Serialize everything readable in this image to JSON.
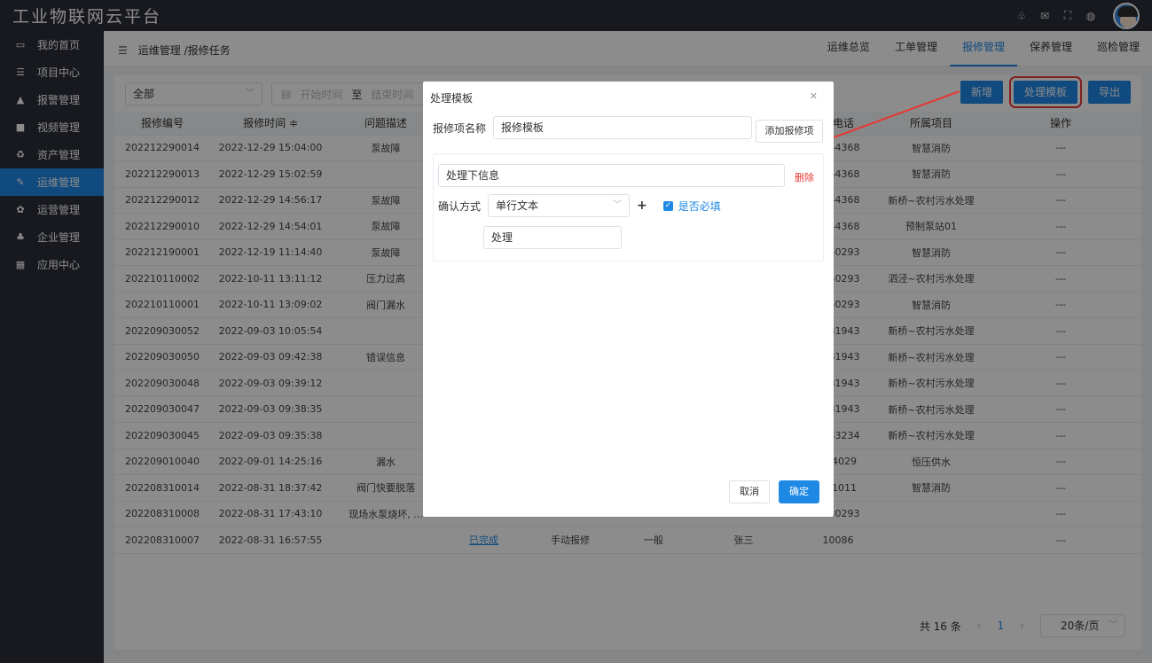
{
  "app": {
    "title": "工业物联网云平台"
  },
  "topbar_icons": [
    "bell-icon",
    "mail-icon",
    "fullscreen-icon",
    "globe-icon"
  ],
  "sidebar": {
    "items": [
      {
        "label": "我的首页",
        "icon": "laptop-icon"
      },
      {
        "label": "项目中心",
        "icon": "list-icon"
      },
      {
        "label": "报警管理",
        "icon": "bell-icon"
      },
      {
        "label": "视频管理",
        "icon": "video-icon"
      },
      {
        "label": "资产管理",
        "icon": "recycle-icon"
      },
      {
        "label": "运维管理",
        "icon": "wrench-icon",
        "active": true
      },
      {
        "label": "运营管理",
        "icon": "cubes-icon"
      },
      {
        "label": "企业管理",
        "icon": "sitemap-icon"
      },
      {
        "label": "应用中心",
        "icon": "grid-icon"
      }
    ]
  },
  "breadcrumb": {
    "text": "运维管理 /报修任务"
  },
  "tabs": [
    {
      "label": "运维总览"
    },
    {
      "label": "工单管理"
    },
    {
      "label": "报修管理",
      "active": true
    },
    {
      "label": "保养管理"
    },
    {
      "label": "巡检管理"
    }
  ],
  "filters": {
    "status_value": "全部",
    "start_placeholder": "开始时间",
    "range_sep": "至",
    "end_placeholder": "结束时间"
  },
  "buttons": {
    "add": "新增",
    "template": "处理模板",
    "export": "导出"
  },
  "table": {
    "headers": [
      "报修编号",
      "报修时间 ≑",
      "问题描述",
      "",
      "",
      "",
      "",
      "系电话",
      "所属项目",
      "操作"
    ],
    "rows": [
      [
        "202212290014",
        "2022-12-29 15:04:00",
        "泵故障",
        "",
        "",
        "",
        "",
        "3654368",
        "智慧消防",
        "---"
      ],
      [
        "202212290013",
        "2022-12-29 15:02:59",
        "",
        "",
        "",
        "",
        "",
        "3654368",
        "智慧消防",
        "---"
      ],
      [
        "202212290012",
        "2022-12-29 14:56:17",
        "泵故障",
        "",
        "",
        "",
        "",
        "3654368",
        "新桥~农村污水处理",
        "---"
      ],
      [
        "202212290010",
        "2022-12-29 14:54:01",
        "泵故障",
        "",
        "",
        "",
        "",
        "3654368",
        "预制泵站01",
        "---"
      ],
      [
        "202212190001",
        "2022-12-19 11:14:40",
        "泵故障",
        "",
        "",
        "",
        "",
        "1050293",
        "智慧消防",
        "---"
      ],
      [
        "202210110002",
        "2022-10-11 13:11:12",
        "压力过高",
        "",
        "",
        "",
        "",
        "1050293",
        "泗泾~农村污水处理",
        "---"
      ],
      [
        "202210110001",
        "2022-10-11 13:09:02",
        "阀门漏水",
        "",
        "",
        "",
        "",
        "1050293",
        "智慧消防",
        "---"
      ],
      [
        "202209030052",
        "2022-09-03 10:05:54",
        "",
        "",
        "",
        "",
        "",
        "4381943",
        "新桥~农村污水处理",
        "---"
      ],
      [
        "202209030050",
        "2022-09-03 09:42:38",
        "错误信息",
        "",
        "",
        "",
        "",
        "4381943",
        "新桥~农村污水处理",
        "---"
      ],
      [
        "202209030048",
        "2022-09-03 09:39:12",
        "",
        "",
        "",
        "",
        "",
        "4381943",
        "新桥~农村污水处理",
        "---"
      ],
      [
        "202209030047",
        "2022-09-03 09:38:35",
        "",
        "",
        "",
        "",
        "",
        "4381943",
        "新桥~农村污水处理",
        "---"
      ],
      [
        "202209030045",
        "2022-09-03 09:35:38",
        "",
        "",
        "",
        "",
        "",
        "4433234",
        "新桥~农村污水处理",
        "---"
      ],
      [
        "202209010040",
        "2022-09-01 14:25:16",
        "漏水",
        "",
        "",
        "",
        "",
        "104029",
        "恒压供水",
        "---"
      ],
      [
        "202208310014",
        "2022-08-31 18:37:42",
        "阀门快要脱落",
        "",
        "",
        "",
        "",
        "101011",
        "智慧消防",
        "---"
      ],
      [
        "202208310008",
        "2022-08-31 17:43:10",
        "现场水泵烧坏, ...",
        "",
        "",
        "",
        "",
        "1080293",
        "",
        "---"
      ],
      [
        "202208310007",
        "2022-08-31 16:57:55",
        "",
        "已完成",
        "手动报修",
        "一般",
        "张三",
        "10086",
        "",
        "---"
      ]
    ]
  },
  "pager": {
    "total": "共 16 条",
    "prev": "‹",
    "page": "1",
    "next": "›",
    "size": "20条/页"
  },
  "dialog": {
    "title": "处理模板",
    "name_label": "报修项名称",
    "name_value": "报修模板",
    "add_item": "添加报修项",
    "item_name_value": "处理下信息",
    "delete": "删除",
    "confirm_label": "确认方式",
    "confirm_value": "单行文本",
    "plus": "+",
    "required_label": "是否必填",
    "option_value": "处理",
    "cancel": "取消",
    "ok": "确定"
  }
}
